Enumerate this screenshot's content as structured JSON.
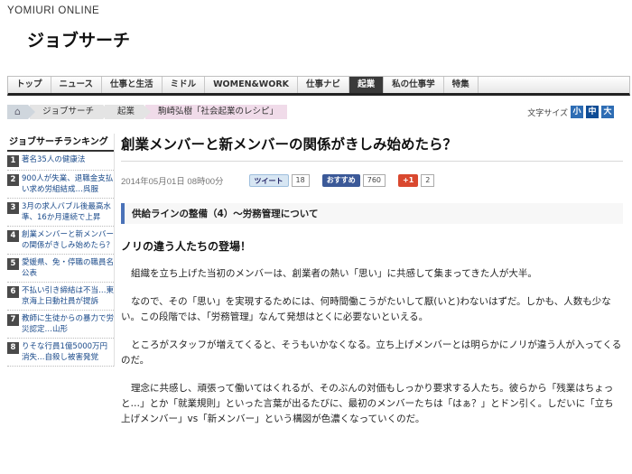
{
  "header": {
    "brand": "YOMIURI ONLINE",
    "title": "ジョブサーチ"
  },
  "nav": {
    "tabs": [
      {
        "label": "トップ",
        "active": false
      },
      {
        "label": "ニュース",
        "active": false
      },
      {
        "label": "仕事と生活",
        "active": false
      },
      {
        "label": "ミドル",
        "active": false
      },
      {
        "label": "WOMEN&WORK",
        "active": false
      },
      {
        "label": "仕事ナビ",
        "active": false
      },
      {
        "label": "起業",
        "active": true
      },
      {
        "label": "私の仕事学",
        "active": false
      },
      {
        "label": "特集",
        "active": false
      }
    ]
  },
  "breadcrumb": {
    "items": [
      "ジョブサーチ",
      "起業",
      "駒崎弘樹「社会起業のレシピ」"
    ]
  },
  "font_size": {
    "label": "文字サイズ",
    "options": [
      "小",
      "中",
      "大"
    ],
    "selected": "中"
  },
  "sidebar": {
    "title": "ジョブサーチランキング",
    "items": [
      {
        "rank": "1",
        "text": "著名35人の健康法"
      },
      {
        "rank": "2",
        "text": "900人が失業、退職金支払い求め労組結成…呉服"
      },
      {
        "rank": "3",
        "text": "3月の求人バブル後最高水準、16か月連続で上昇"
      },
      {
        "rank": "4",
        "text": "創業メンバーと新メンバーの関係がきしみ始めたら？"
      },
      {
        "rank": "5",
        "text": "愛媛県、免・停職の職員名公表"
      },
      {
        "rank": "6",
        "text": "不払い引き締結は不当…東京海上日動社員が提訴"
      },
      {
        "rank": "7",
        "text": "教師に生徒からの暴力で労災認定…山形"
      },
      {
        "rank": "8",
        "text": "りそな行員1億5000万円消失…自殺し被害発覚"
      }
    ]
  },
  "article": {
    "headline": "創業メンバーと新メンバーの関係がきしみ始めたら？",
    "date": "2014年05月01日 08時00分",
    "share": {
      "tweet_label": "ツイート",
      "tweet_count": "18",
      "fb_label": "おすすめ",
      "fb_count": "760",
      "gplus_label": "+1",
      "gplus_count": "2"
    },
    "section_title": "供給ラインの整備（4）～労務管理について",
    "subheading": "ノリの違う人たちの登場！",
    "paragraphs": [
      "組織を立ち上げた当初のメンバーは、創業者の熱い「思い」に共感して集まってきた人が大半。",
      "なので、その「思い」を実現するためには、何時間働こうがたいして厭(いと)わないはずだ。しかも、人数も少ない。この段階では、「労務管理」なんて発想はとくに必要ないといえる。",
      "ところがスタッフが増えてくると、そうもいかなくなる。立ち上げメンバーとは明らかにノリが違う人が入ってくるのだ。",
      "理念に共感し、頑張って働いてはくれるが、そのぶんの対価もしっかり要求する人たち。彼らから「残業はちょっと…」とか「就業規則」といった言葉が出るたびに、最初のメンバーたちは「はぁ？」とドン引く。しだいに「立ち上げメンバー」vs「新メンバー」という構図が色濃くなっていくのだ。"
    ]
  },
  "colors": {
    "nav_active": "#3a3a3a",
    "link": "#1a4a8a",
    "section_bar": "#4a72b8",
    "current_crumb": "#f0dbe9"
  }
}
